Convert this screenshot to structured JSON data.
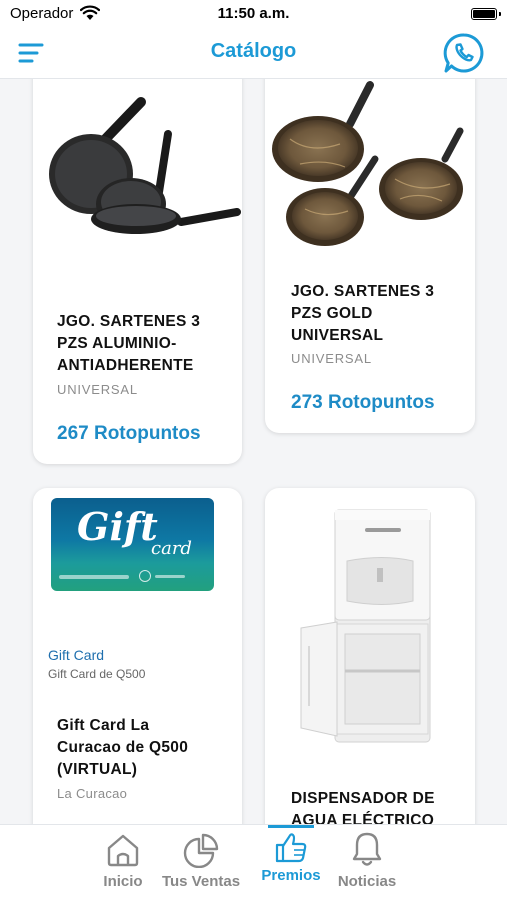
{
  "status_bar": {
    "carrier": "Operador",
    "time": "11:50 a.m."
  },
  "header": {
    "title": "Catálogo",
    "menu_icon": "hamburger-icon",
    "whatsapp_icon": "whatsapp-icon"
  },
  "products": [
    {
      "name_lines": [
        "JGO. SARTENES 3",
        "PZS ALUMINIO-",
        "ANTIADHERENTE"
      ],
      "brand": "UNIVERSAL",
      "points": "267 Rotopuntos",
      "image": "black-pans-image"
    },
    {
      "name_lines": [
        "JGO. SARTENES 3",
        "PZS GOLD",
        "UNIVERSAL"
      ],
      "brand": "UNIVERSAL",
      "points": "273 Rotopuntos",
      "image": "gold-pans-image"
    },
    {
      "name_lines": [
        "Gift Card La",
        "Curacao de Q500",
        "(VIRTUAL)"
      ],
      "brand": "La Curacao",
      "card_label": "Gift Card",
      "card_sublabel": "Gift Card de Q500",
      "card_script_top": "Gift",
      "card_script_bottom": "card",
      "image": "gift-card-image"
    },
    {
      "name_lines": [
        "DISPENSADOR DE",
        "AGUA ELÉCTRICO"
      ],
      "image": "water-dispenser-image"
    }
  ],
  "tabbar": {
    "tabs": [
      {
        "label": "Inicio",
        "icon": "home-icon",
        "active": false
      },
      {
        "label": "Tus Ventas",
        "icon": "pie-chart-icon",
        "active": false
      },
      {
        "label": "Premios",
        "icon": "thumbs-up-icon",
        "active": true
      },
      {
        "label": "Noticias",
        "icon": "bell-icon",
        "active": false
      }
    ]
  },
  "colors": {
    "accent": "#1c9ad6",
    "points": "#1e8bc6",
    "brand_gray": "#8c8c8c",
    "giftcard_bg": "#0e6f9a",
    "giftcard_green": "#1fa489"
  }
}
